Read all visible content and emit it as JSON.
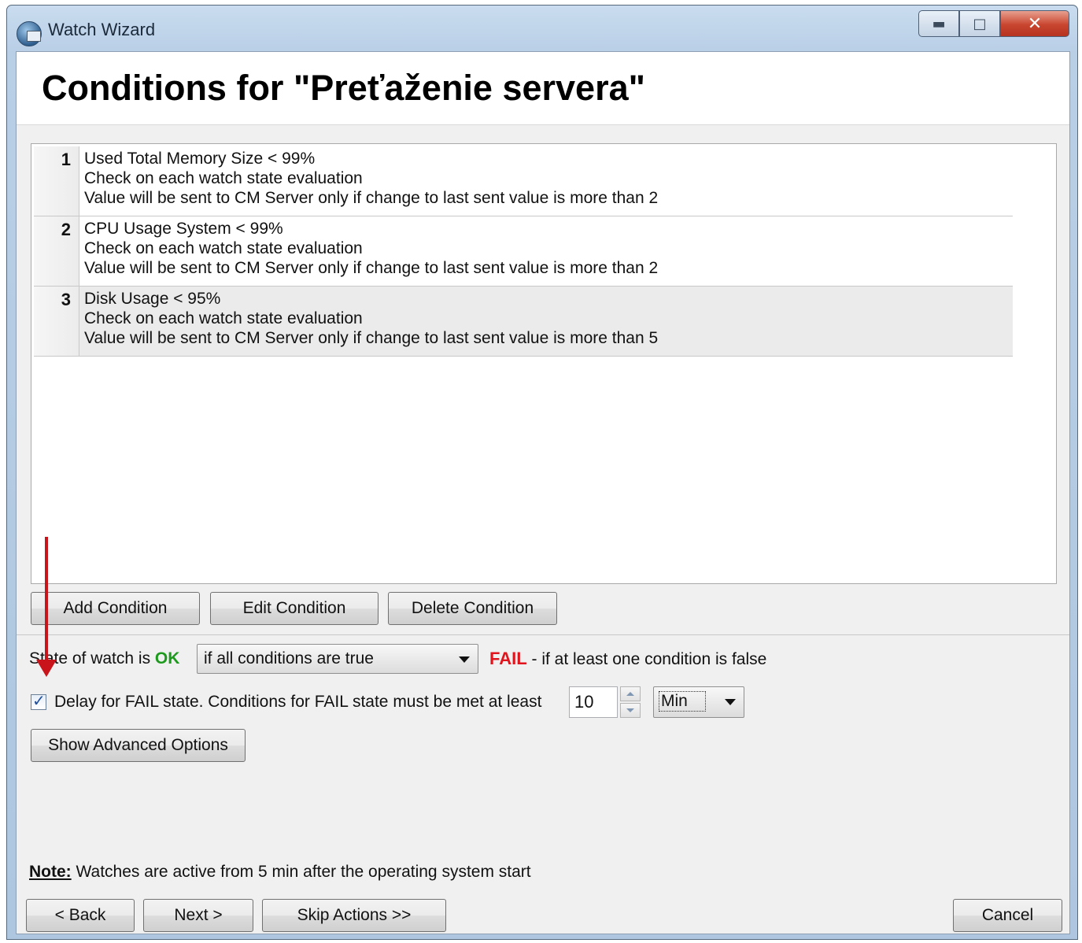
{
  "window": {
    "title": "Watch Wizard",
    "page_title": "Conditions for \"Preťaženie servera\""
  },
  "conditions": [
    {
      "num": "1",
      "line1": "Used Total Memory Size < 99%",
      "line2": "Check on each watch state evaluation",
      "line3": "Value will be sent to CM Server only if change to last sent value is more than 2"
    },
    {
      "num": "2",
      "line1": "CPU Usage System < 99%",
      "line2": "Check on each watch state evaluation",
      "line3": "Value will be sent to CM Server only if change to last sent value is more than 2"
    },
    {
      "num": "3",
      "line1": "Disk Usage < 95%",
      "line2": "Check on each watch state evaluation",
      "line3": "Value will be sent to CM Server only if change to last sent value is more than 5"
    }
  ],
  "buttons": {
    "add": "Add Condition",
    "edit": "Edit Condition",
    "delete": "Delete Condition",
    "advanced": "Show Advanced Options",
    "back": "< Back",
    "next": "Next >",
    "skip": "Skip Actions >>",
    "cancel": "Cancel"
  },
  "state": {
    "prefix": "State of watch is",
    "ok_label": "OK",
    "condition_select": "if all conditions are true",
    "fail_label": "FAIL",
    "fail_suffix": " - if at least one condition is false"
  },
  "delay": {
    "checked": true,
    "label": "Delay for FAIL state. Conditions for FAIL state must be met at least",
    "value": "10",
    "unit": "Min"
  },
  "note": {
    "label": "Note:",
    "text": " Watches are active from 5 min after the operating system start"
  },
  "colors": {
    "ok": "#1d9a1d",
    "fail": "#e0141c",
    "annotation_arrow": "#c8141a"
  },
  "icons": {
    "app": "watch-wizard-app-icon",
    "minimize": "minimize-icon",
    "maximize": "maximize-icon",
    "close": "close-icon"
  }
}
